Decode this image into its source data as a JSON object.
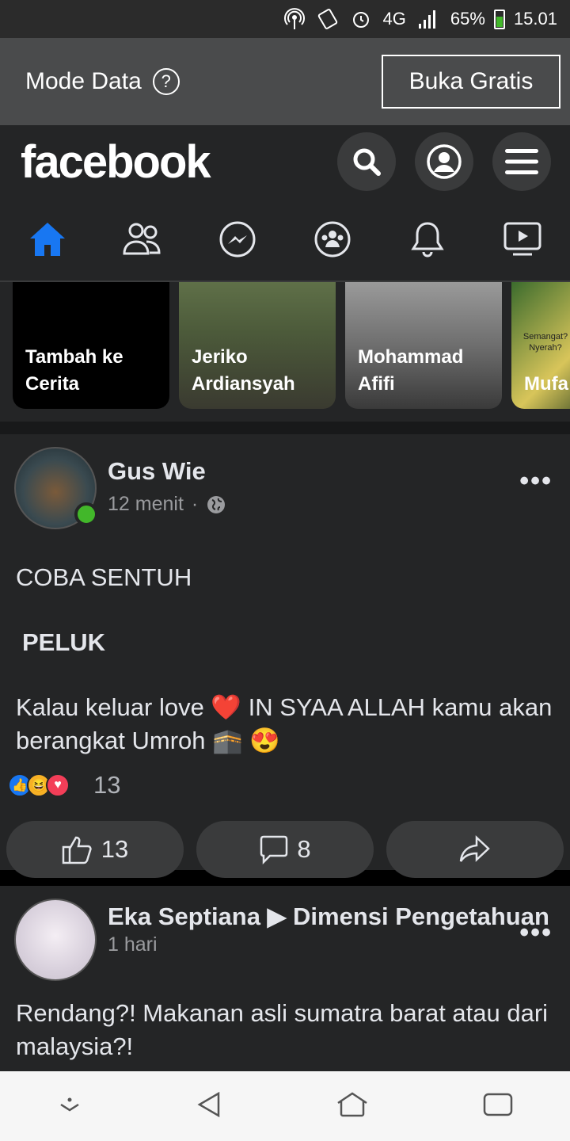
{
  "status_bar": {
    "signal_label": "4G",
    "battery": "65%",
    "time": "15.01"
  },
  "data_mode": {
    "label": "Mode Data",
    "help_icon": "?",
    "open_free_button": "Buka Gratis"
  },
  "header": {
    "logo": "facebook"
  },
  "stories": [
    {
      "label": "Tambah ke Cerita"
    },
    {
      "label": "Jeriko Ardiansyah"
    },
    {
      "label": "Mohammad Afifi"
    },
    {
      "label": "Mufa",
      "overlay_text": "Semangat? Nyerah?"
    }
  ],
  "post1": {
    "author": "Gus Wie",
    "time": "12 menit",
    "line1": "COBA SENTUH",
    "line2": "PELUK",
    "line3": "Kalau keluar love ❤️ IN SYAA ALLAH kamu akan berangkat Umroh 🕋 😍",
    "reaction_count": "13",
    "like_count": "13",
    "comment_count": "8"
  },
  "post2": {
    "author": "Eka Septiana ▶ Dimensi Pengetahuan",
    "time": "1 hari",
    "text": "Rendang?!  Makanan asli sumatra barat atau dari malaysia?!"
  },
  "colors": {
    "accent": "#1877f2",
    "online": "#42b72a",
    "background": "#18191a",
    "card": "#242526"
  }
}
